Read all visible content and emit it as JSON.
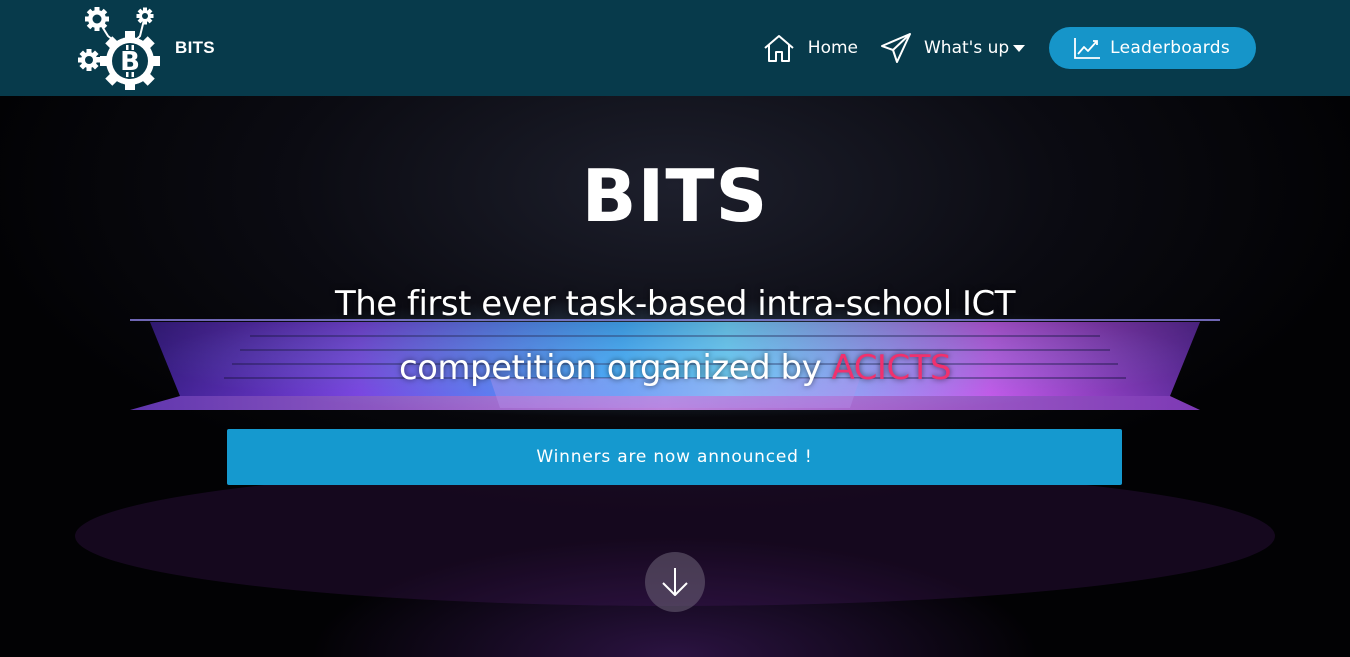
{
  "navbar": {
    "brand_name": "BITS",
    "items": [
      {
        "label": "Home",
        "icon": "home-icon"
      },
      {
        "label": "What's up",
        "icon": "paper-plane-icon",
        "has_dropdown": true
      },
      {
        "label": "Leaderboards",
        "icon": "chart-line-icon"
      }
    ]
  },
  "hero": {
    "title": "BITS",
    "subtitle_line1": "The first ever task-based intra-school ICT",
    "subtitle_line2": "competition organized by",
    "subtitle_accent": "ACICTS",
    "announcement": "Winners are now announced !",
    "scroll_icon": "arrow-down-icon"
  },
  "colors": {
    "navbar_bg": "#073a4b",
    "primary": "#1599cf",
    "accent": "#f0316e"
  }
}
